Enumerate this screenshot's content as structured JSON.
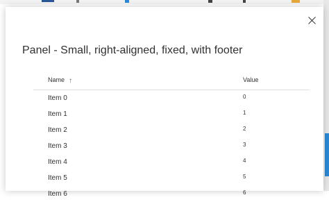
{
  "panel": {
    "title": "Panel - Small, right-aligned, fixed, with footer",
    "close_icon": "close-icon"
  },
  "list": {
    "columns": [
      {
        "label": "Name",
        "sort_icon": "sort-ascending-arrow-icon",
        "sort_glyph": "↑"
      },
      {
        "label": "Value"
      }
    ],
    "rows": [
      {
        "name": "Item 0",
        "value": "0"
      },
      {
        "name": "Item 1",
        "value": "1"
      },
      {
        "name": "Item 2",
        "value": "2"
      },
      {
        "name": "Item 3",
        "value": "3"
      },
      {
        "name": "Item 4",
        "value": "4"
      },
      {
        "name": "Item 5",
        "value": "5"
      },
      {
        "name": "Item 6",
        "value": "6"
      }
    ]
  },
  "colors": {
    "text": "#323130",
    "divider": "#e1dfdd",
    "accent": "#2b88d8"
  }
}
